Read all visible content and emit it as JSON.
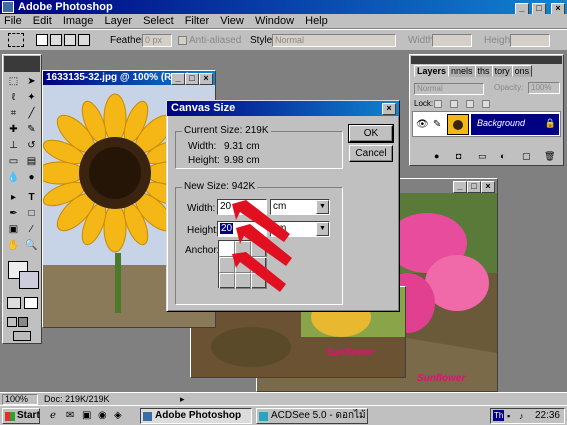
{
  "app": {
    "title": "Adobe Photoshop"
  },
  "menu": [
    "File",
    "Edit",
    "Image",
    "Layer",
    "Select",
    "Filter",
    "View",
    "Window",
    "Help"
  ],
  "options_bar": {
    "feather_label": "Feather:",
    "feather_value": "0 px",
    "anti_aliased_label": "Anti-aliased",
    "style_label": "Style:",
    "style_value": "Normal",
    "width_label": "Width:",
    "height_label": "Height:"
  },
  "document_windows": [
    {
      "title": "1633135-32.jpg @ 100% (RGB)",
      "caption": ""
    },
    {
      "title": "",
      "caption": "Sunflower"
    },
    {
      "title": "",
      "caption": "Sunflower"
    },
    {
      "title": "",
      "caption": "Sunflower"
    }
  ],
  "dialog": {
    "title": "Canvas Size",
    "current_size_label": "Current Size: 219K",
    "current_width_label": "Width:",
    "current_width_value": "9.31 cm",
    "current_height_label": "Height:",
    "current_height_value": "9.98 cm",
    "new_size_label": "New Size: 942K",
    "new_width_label": "Width:",
    "new_width_value": "20",
    "new_width_unit": "cm",
    "new_height_label": "Height:",
    "new_height_value": "20",
    "new_height_unit": "cm",
    "anchor_label": "Anchor:",
    "ok_label": "OK",
    "cancel_label": "Cancel"
  },
  "layers_panel": {
    "tabs": [
      "Layers",
      "nnels",
      "ths",
      "tory",
      "ons"
    ],
    "blend_mode": "Normal",
    "opacity_label": "Opacity:",
    "opacity_value": "100%",
    "lock_label": "Lock:",
    "layer_name": "Background"
  },
  "status_bar": {
    "zoom": "100%",
    "doc_info": "Doc: 219K/219K"
  },
  "taskbar": {
    "start_label": "Start",
    "tasks": [
      "Adobe Photoshop",
      "ACDSee 5.0 - ดอกไม้"
    ],
    "tray_lang": "Th",
    "clock": "22:36"
  },
  "colors": {
    "title_bar": "#000080",
    "arrow_red": "#e01020",
    "caption_pink": "#e0107a",
    "layer_selected": "#000080"
  }
}
